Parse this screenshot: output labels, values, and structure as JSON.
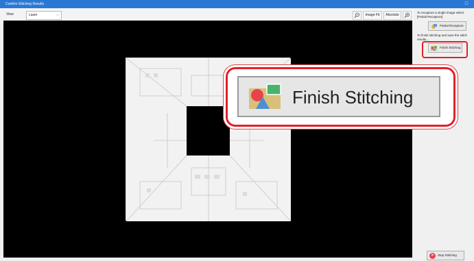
{
  "window": {
    "title": "Confirm Stitching Results",
    "close_glyph": "□"
  },
  "toolbar": {
    "view_label": "View",
    "view_value": "Laser",
    "view_chevron": "⌵",
    "image_fit_label": "Image Fit",
    "absolute_label": "Absolute",
    "zoom_out_icon": "zoom-out-icon",
    "zoom_in_icon": "zoom-in-icon"
  },
  "right_panel": {
    "recapture_text": "To recapture a single image select [Partial Recapture].",
    "partial_recapture_label": "Partial Recapture",
    "finish_text": "To finish stitching and save the stitch results...",
    "finish_stitching_label": "Finish Stitching",
    "stop_stitching_label": "Stop Stitching",
    "stop_glyph": "✕"
  },
  "callout": {
    "label": "Finish Stitching"
  },
  "colors": {
    "titlebar": "#2b78d4",
    "highlight": "#e0202a",
    "canvas": "#000000"
  }
}
